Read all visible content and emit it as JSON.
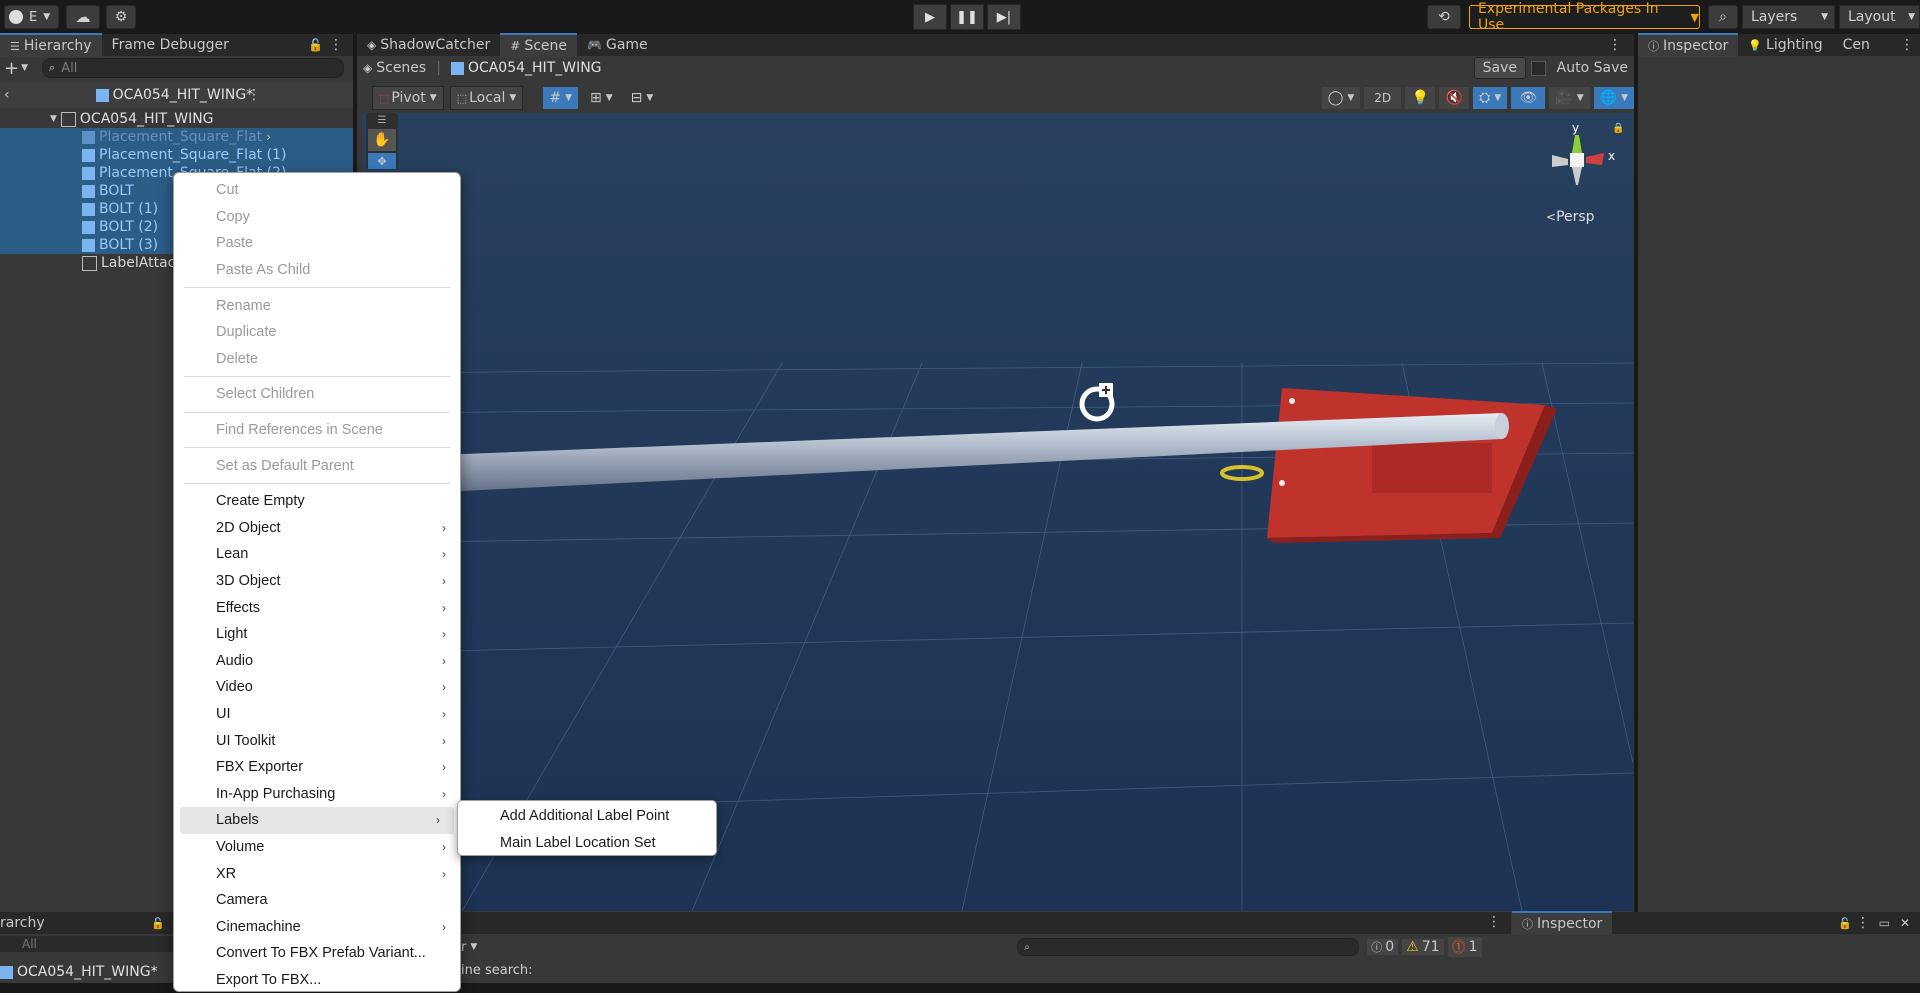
{
  "toolbar": {
    "account_label": "E",
    "experimental_label": "Experimental Packages In Use",
    "layers_label": "Layers",
    "layout_label": "Layout"
  },
  "hierarchy": {
    "tabs": [
      "Hierarchy",
      "Frame Debugger"
    ],
    "search_placeholder": "All",
    "scene_title": "OCA054_HIT_WING*",
    "root": "OCA054_HIT_WING",
    "items": [
      {
        "label": "Placement_Square_Flat"
      },
      {
        "label": "Placement_Square_Flat (1)"
      },
      {
        "label": "Placement_Square_Flat (2)"
      },
      {
        "label": "BOLT"
      },
      {
        "label": "BOLT (1)"
      },
      {
        "label": "BOLT (2)"
      },
      {
        "label": "BOLT (3)"
      },
      {
        "label": "LabelAttac"
      }
    ]
  },
  "scene": {
    "tabs": [
      "ShadowCatcher",
      "Scene",
      "Game"
    ],
    "breadcrumb_root": "Scenes",
    "breadcrumb_item": "OCA054_HIT_WING",
    "save_label": "Save",
    "autosave_label": "Auto Save",
    "pivot_label": "Pivot",
    "local_label": "Local",
    "mode_2d": "2D",
    "persp_label": "Persp",
    "gizmo_y": "y",
    "gizmo_x": "x"
  },
  "inspector": {
    "tabs": [
      "Inspector",
      "Lighting",
      "Cen"
    ]
  },
  "bottom": {
    "hierarchy_tab": "rarchy",
    "search_placeholder": "All",
    "scene_item": "OCA054_HIT_WING*",
    "console_dropdown": "r",
    "console_text": "ine search:",
    "count_info": "0",
    "count_warn": "71",
    "count_err": "1",
    "inspector_tab": "Inspector"
  },
  "menu": {
    "items": [
      {
        "label": "Cut",
        "disabled": true
      },
      {
        "label": "Copy",
        "disabled": true
      },
      {
        "label": "Paste",
        "disabled": true
      },
      {
        "label": "Paste As Child",
        "disabled": true
      },
      {
        "sep": true
      },
      {
        "label": "Rename",
        "disabled": true
      },
      {
        "label": "Duplicate",
        "disabled": true
      },
      {
        "label": "Delete",
        "disabled": true
      },
      {
        "sep": true
      },
      {
        "label": "Select Children",
        "disabled": true
      },
      {
        "sep": true
      },
      {
        "label": "Find References in Scene",
        "disabled": true
      },
      {
        "sep": true
      },
      {
        "label": "Set as Default Parent",
        "disabled": true
      },
      {
        "sep": true
      },
      {
        "label": "Create Empty"
      },
      {
        "label": "2D Object",
        "sub": true
      },
      {
        "label": "Lean",
        "sub": true
      },
      {
        "label": "3D Object",
        "sub": true
      },
      {
        "label": "Effects",
        "sub": true
      },
      {
        "label": "Light",
        "sub": true
      },
      {
        "label": "Audio",
        "sub": true
      },
      {
        "label": "Video",
        "sub": true
      },
      {
        "label": "UI",
        "sub": true
      },
      {
        "label": "UI Toolkit",
        "sub": true
      },
      {
        "label": "FBX Exporter",
        "sub": true
      },
      {
        "label": "In-App Purchasing",
        "sub": true
      },
      {
        "label": "Labels",
        "sub": true,
        "hover": true
      },
      {
        "label": "Volume",
        "sub": true
      },
      {
        "label": "XR",
        "sub": true
      },
      {
        "label": "Camera"
      },
      {
        "label": "Cinemachine",
        "sub": true
      },
      {
        "label": "Convert To FBX Prefab Variant..."
      },
      {
        "label": "Export To FBX..."
      }
    ],
    "submenu": [
      "Add Additional Label Point",
      "Main Label Location Set"
    ]
  },
  "colors": {
    "selection": "#2c5d87",
    "prefab_blue": "#7cb4f2",
    "accent": "#f0a30a",
    "scene_bg": "#22395a",
    "model_red": "#c0322c"
  }
}
